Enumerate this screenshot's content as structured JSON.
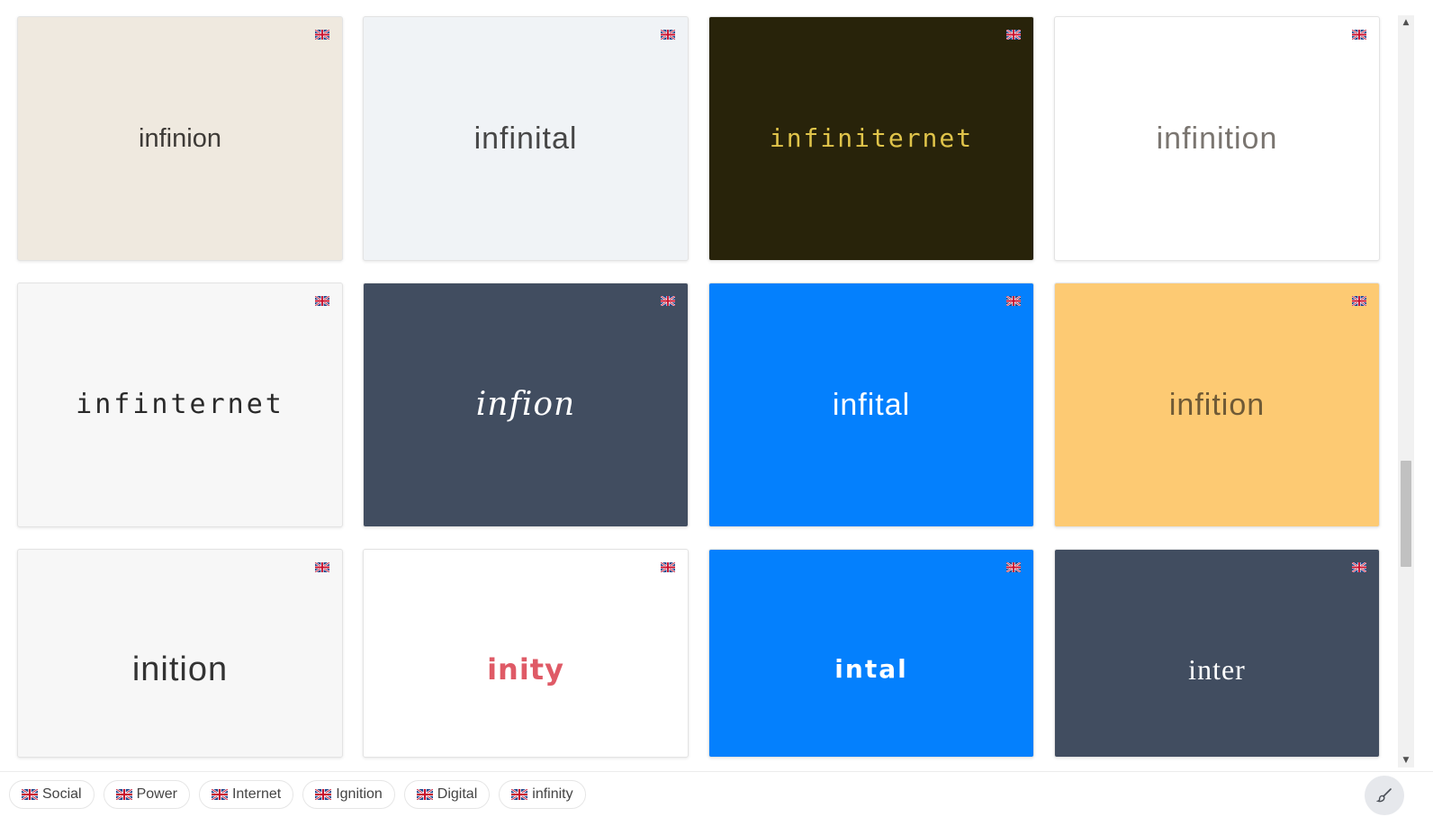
{
  "cards": [
    {
      "name": "infinion",
      "bg": "#efe9df",
      "color": "#3d3a36",
      "font": "\"Liberation Sans\", sans-serif",
      "size": "29px",
      "weight": "normal",
      "style": "normal",
      "spacing": "0px",
      "flag_icon": "uk-flag-icon"
    },
    {
      "name": "infinital",
      "bg": "#f0f3f6",
      "color": "#474747",
      "font": "\"Liberation Sans\", sans-serif",
      "size": "34px",
      "weight": "normal",
      "style": "normal",
      "spacing": "1px",
      "flag_icon": "uk-flag-icon"
    },
    {
      "name": "infiniternet",
      "bg": "#28230a",
      "color": "#e0c44a",
      "font": "\"DejaVu Sans Mono\", monospace",
      "size": "28px",
      "weight": "normal",
      "style": "normal",
      "spacing": "2px",
      "flag_icon": "uk-flag-icon"
    },
    {
      "name": "infinition",
      "bg": "#ffffff",
      "color": "#7a7570",
      "font": "\"Liberation Sans\", sans-serif",
      "size": "34px",
      "weight": "normal",
      "style": "normal",
      "spacing": "1px",
      "flag_icon": "uk-flag-icon"
    },
    {
      "name": "infinternet",
      "bg": "#f7f7f7",
      "color": "#2a2a2a",
      "font": "\"DejaVu Sans Mono\", monospace",
      "size": "30px",
      "weight": "normal",
      "style": "normal",
      "spacing": "3px",
      "flag_icon": "uk-flag-icon"
    },
    {
      "name": "infion",
      "bg": "#414d60",
      "color": "#ffffff",
      "font": "\"DejaVu Serif\", serif",
      "size": "36px",
      "weight": "normal",
      "style": "italic",
      "spacing": "1px",
      "flag_icon": "uk-flag-icon"
    },
    {
      "name": "infital",
      "bg": "#0480fd",
      "color": "#ffffff",
      "font": "\"Liberation Sans\", sans-serif",
      "size": "34px",
      "weight": "normal",
      "style": "normal",
      "spacing": "1px",
      "flag_icon": "uk-flag-icon"
    },
    {
      "name": "infition",
      "bg": "#fdca73",
      "color": "#6f5a36",
      "font": "\"Liberation Sans\", sans-serif",
      "size": "34px",
      "weight": "normal",
      "style": "normal",
      "spacing": "1px",
      "flag_icon": "uk-flag-icon"
    },
    {
      "name": "inition",
      "bg": "#f7f7f7",
      "color": "#333333",
      "font": "\"Liberation Sans\", sans-serif",
      "size": "38px",
      "weight": "normal",
      "style": "normal",
      "spacing": "1px",
      "flag_icon": "uk-flag-icon"
    },
    {
      "name": "inity",
      "bg": "#ffffff",
      "color": "#df5a66",
      "font": "\"DejaVu Sans\", sans-serif",
      "size": "32px",
      "weight": "bold",
      "style": "normal",
      "spacing": "1px",
      "flag_icon": "uk-flag-icon"
    },
    {
      "name": "intal",
      "bg": "#0480fd",
      "color": "#ffffff",
      "font": "\"DejaVu Sans\", sans-serif",
      "size": "28px",
      "weight": "bold",
      "style": "normal",
      "spacing": "2px",
      "flag_icon": "uk-flag-icon"
    },
    {
      "name": "inter",
      "bg": "#414d60",
      "color": "#ffffff",
      "font": "\"Liberation Serif\", serif",
      "size": "32px",
      "weight": "normal",
      "style": "normal",
      "spacing": "1px",
      "flag_icon": "uk-flag-icon"
    }
  ],
  "footer": {
    "tags": [
      {
        "label": "Social",
        "flag_icon": "uk-flag-icon"
      },
      {
        "label": "Power",
        "flag_icon": "uk-flag-icon"
      },
      {
        "label": "Internet",
        "flag_icon": "uk-flag-icon"
      },
      {
        "label": "Ignition",
        "flag_icon": "uk-flag-icon"
      },
      {
        "label": "Digital",
        "flag_icon": "uk-flag-icon"
      },
      {
        "label": "infinity",
        "flag_icon": "uk-flag-icon"
      }
    ],
    "action_icon": "paintbrush-icon"
  },
  "scrollbar": {
    "up_icon": "scroll-up-arrow-icon",
    "down_icon": "scroll-down-arrow-icon"
  }
}
